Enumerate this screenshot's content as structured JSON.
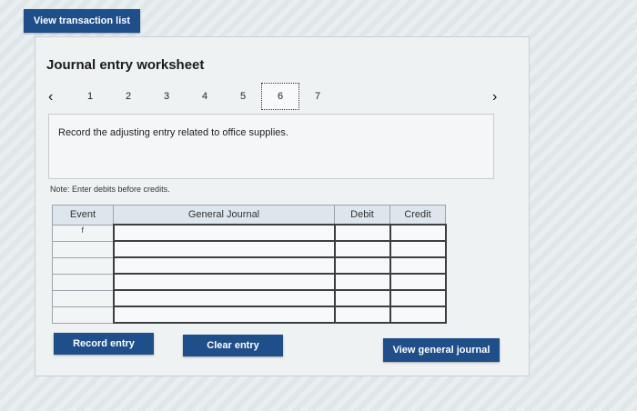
{
  "top_button": {
    "label": "View transaction list"
  },
  "worksheet": {
    "title": "Journal entry worksheet",
    "pages": [
      "1",
      "2",
      "3",
      "4",
      "5",
      "6",
      "7"
    ],
    "active_page": "6",
    "instruction": "Record the adjusting entry related to office supplies.",
    "note": "Note: Enter debits before credits."
  },
  "table": {
    "headers": {
      "event": "Event",
      "journal": "General Journal",
      "debit": "Debit",
      "credit": "Credit"
    },
    "first_event": "f"
  },
  "buttons": {
    "record": "Record entry",
    "clear": "Clear entry",
    "view_general": "View general journal"
  },
  "colors": {
    "primary_button": "#1f4f8a",
    "header_bg": "#dde6ec"
  }
}
